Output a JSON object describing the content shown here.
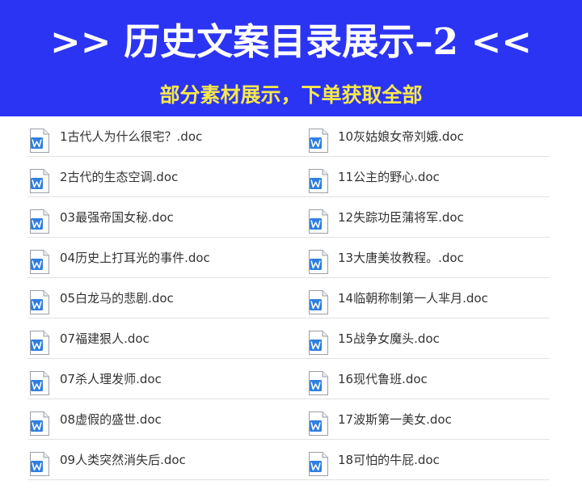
{
  "banner": {
    "title": ">> 历史文案目录展示–2 <<",
    "subtitle": "部分素材展示，下单获取全部",
    "background_color": "#2b34f2",
    "subtitle_color": "#f6e84a"
  },
  "files": {
    "icon": "word-doc-icon",
    "left": [
      {
        "name": "1古代人为什么很宅？.doc"
      },
      {
        "name": "2古代的生态空调.doc"
      },
      {
        "name": "03最强帝国女秘.doc"
      },
      {
        "name": "04历史上打耳光的事件.doc"
      },
      {
        "name": "05白龙马的悲剧.doc"
      },
      {
        "name": "07福建狠人.doc"
      },
      {
        "name": "07杀人理发师.doc"
      },
      {
        "name": "08虚假的盛世.doc"
      },
      {
        "name": "09人类突然消失后.doc"
      }
    ],
    "right": [
      {
        "name": "10灰姑娘女帝刘娥.doc"
      },
      {
        "name": "11公主的野心.doc"
      },
      {
        "name": "12失踪功臣蒲将军.doc"
      },
      {
        "name": "13大唐美妆教程。.doc"
      },
      {
        "name": "14临朝称制第一人芈月.doc"
      },
      {
        "name": "15战争女魔头.doc"
      },
      {
        "name": "16现代鲁班.doc"
      },
      {
        "name": "17波斯第一美女.doc"
      },
      {
        "name": "18可怕的牛屁.doc"
      }
    ]
  }
}
